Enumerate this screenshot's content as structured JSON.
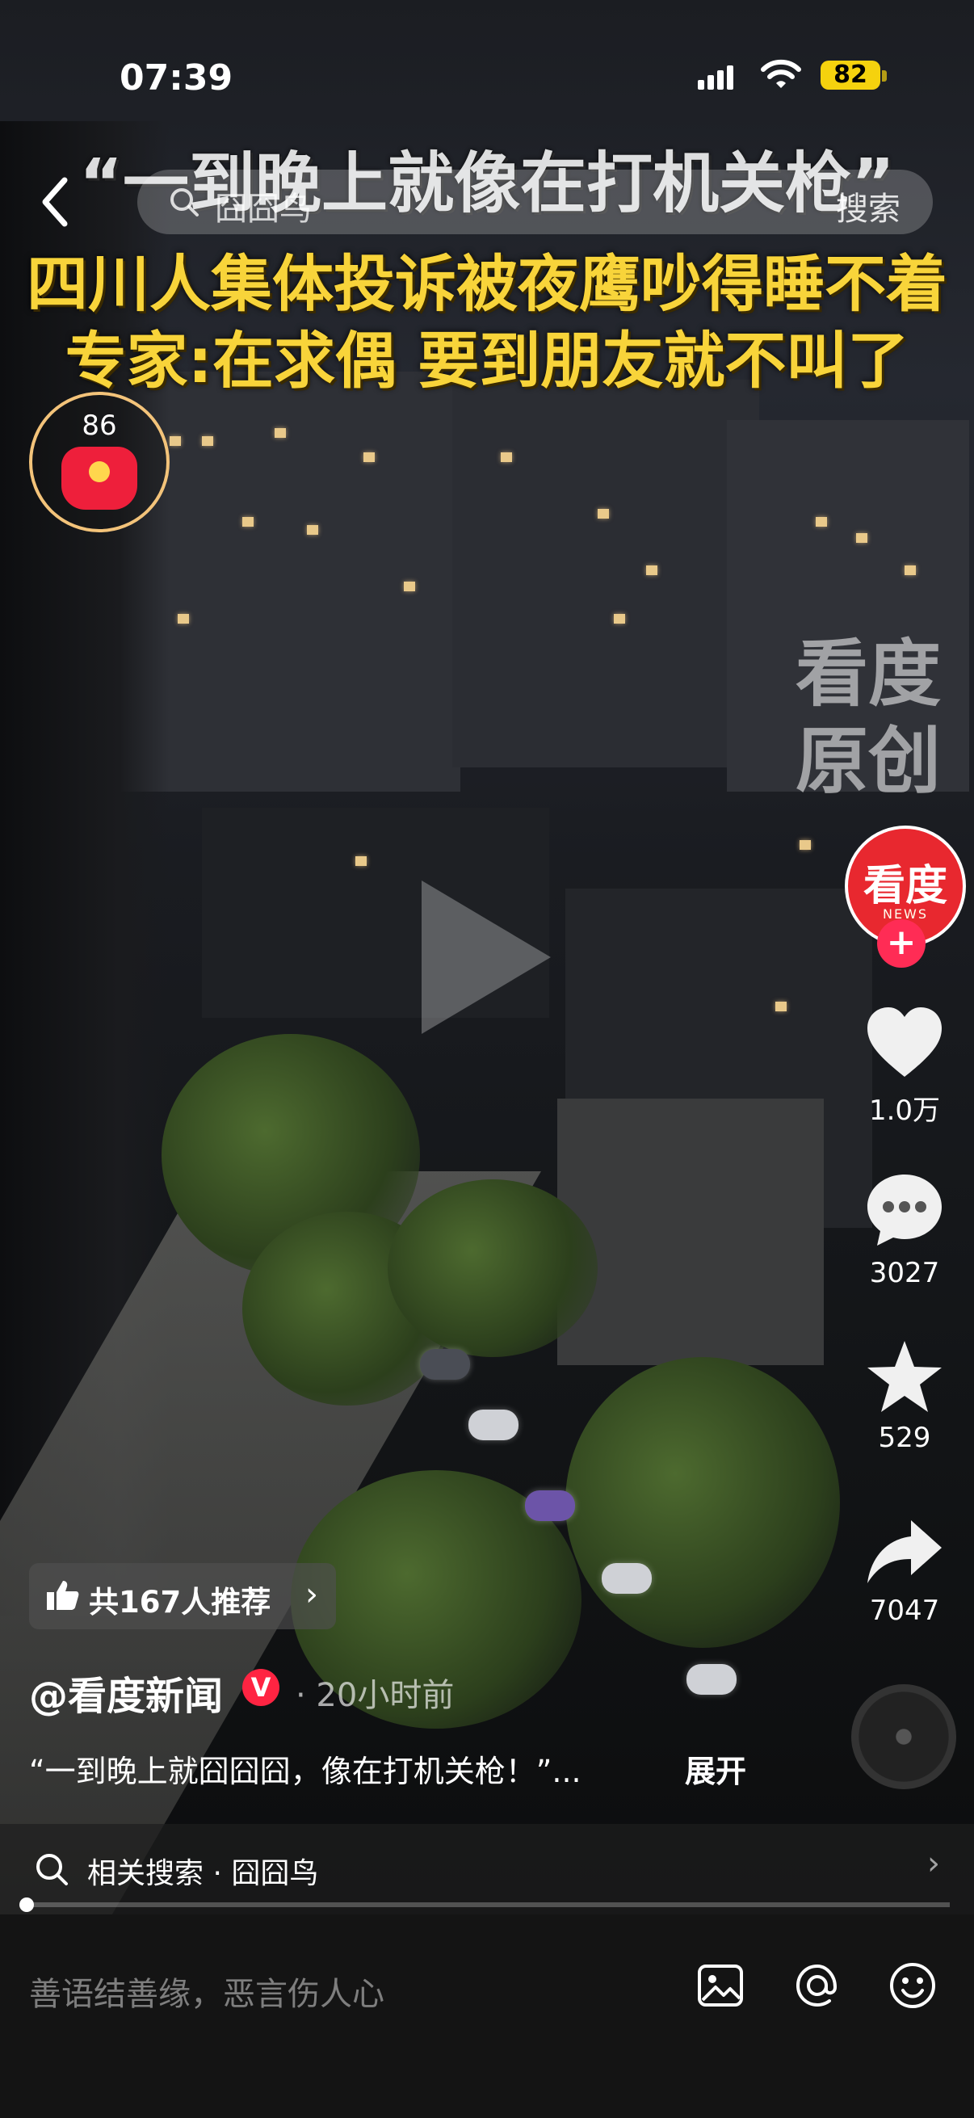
{
  "status_bar": {
    "time": "07:39",
    "battery": "82"
  },
  "video": {
    "title_line1": "“一到晚上就像在打机关枪”",
    "title_line2": "四川人集体投诉被夜鹰吵得睡不着",
    "title_line3": "专家:在求偶 要到朋友就不叫了",
    "watermark_line1": "看度",
    "watermark_line2": "原创"
  },
  "search": {
    "query": "囧囧鸟",
    "button": "搜索"
  },
  "red_packet": {
    "count": "86"
  },
  "author_avatar": {
    "text": "看度",
    "sub": "NEWS"
  },
  "actions": {
    "likes": "1.0万",
    "comments": "3027",
    "favorites": "529",
    "shares": "7047"
  },
  "info": {
    "recommend": "共167人推荐",
    "author": "@看度新闻",
    "verified": "V",
    "time": "· 20小时前",
    "caption": "“一到晚上就囧囧囧，像在打机关枪！”...",
    "expand": "展开",
    "related_search": "相关搜索 · 囧囧鸟"
  },
  "comment_input": {
    "placeholder": "善语结善缘，恶言伤人心"
  },
  "progress": 0.0
}
